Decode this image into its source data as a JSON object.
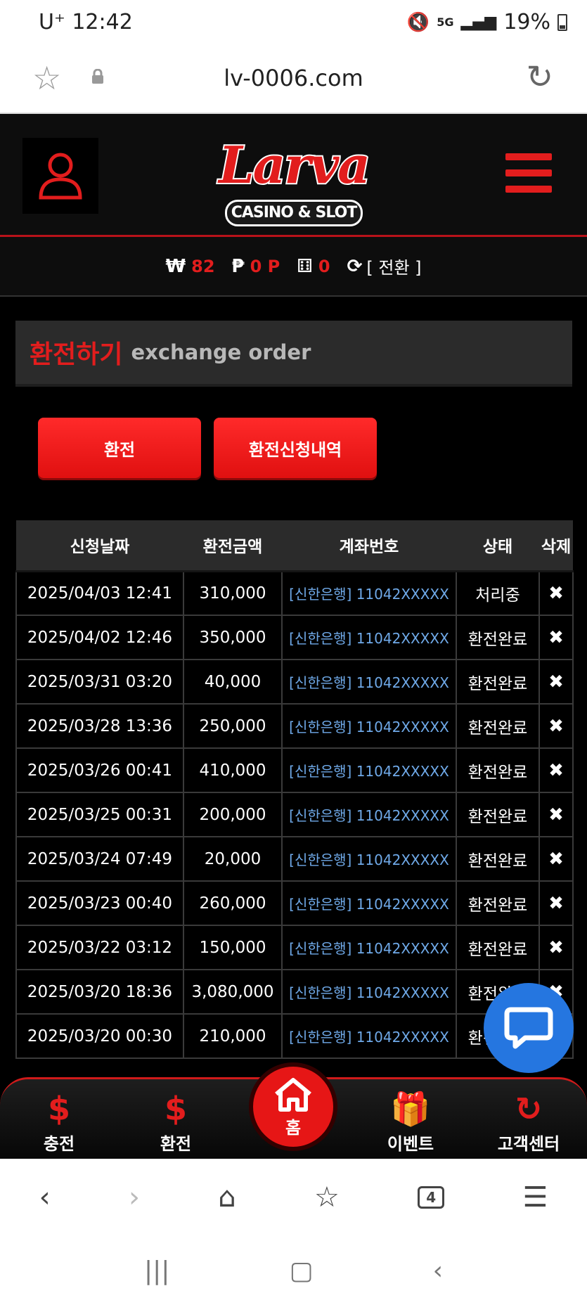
{
  "status_bar": {
    "time": "12:42",
    "carrier": "U⁺",
    "network": "5G",
    "battery": "19%"
  },
  "browser": {
    "url": "lv-0006.com"
  },
  "header": {
    "logo_text": "Larva",
    "logo_sub": "CASINO & SLOT"
  },
  "balance": {
    "won_symbol": "₩",
    "won_value": "82",
    "point_symbol": "₱",
    "point_value": "0 P",
    "chip_value": "0",
    "switch_label": "[ 전환 ]"
  },
  "section": {
    "title_ko": "환전하기",
    "title_en": "exchange order"
  },
  "actions": {
    "exchange_label": "환전",
    "history_label": "환전신청내역"
  },
  "table": {
    "headers": [
      "신청날짜",
      "환전금액",
      "계좌번호",
      "상태",
      "삭제"
    ],
    "rows": [
      {
        "date": "2025/04/03 12:41",
        "amount": "310,000",
        "account": "[신한은행] 11042XXXXX",
        "status": "처리중",
        "del": "✖"
      },
      {
        "date": "2025/04/02 12:46",
        "amount": "350,000",
        "account": "[신한은행] 11042XXXXX",
        "status": "환전완료",
        "del": "✖"
      },
      {
        "date": "2025/03/31 03:20",
        "amount": "40,000",
        "account": "[신한은행] 11042XXXXX",
        "status": "환전완료",
        "del": "✖"
      },
      {
        "date": "2025/03/28 13:36",
        "amount": "250,000",
        "account": "[신한은행] 11042XXXXX",
        "status": "환전완료",
        "del": "✖"
      },
      {
        "date": "2025/03/26 00:41",
        "amount": "410,000",
        "account": "[신한은행] 11042XXXXX",
        "status": "환전완료",
        "del": "✖"
      },
      {
        "date": "2025/03/25 00:31",
        "amount": "200,000",
        "account": "[신한은행] 11042XXXXX",
        "status": "환전완료",
        "del": "✖"
      },
      {
        "date": "2025/03/24 07:49",
        "amount": "20,000",
        "account": "[신한은행] 11042XXXXX",
        "status": "환전완료",
        "del": "✖"
      },
      {
        "date": "2025/03/23 00:40",
        "amount": "260,000",
        "account": "[신한은행] 11042XXXXX",
        "status": "환전완료",
        "del": "✖"
      },
      {
        "date": "2025/03/22 03:12",
        "amount": "150,000",
        "account": "[신한은행] 11042XXXXX",
        "status": "환전완료",
        "del": "✖"
      },
      {
        "date": "2025/03/20 18:36",
        "amount": "3,080,000",
        "account": "[신한은행] 11042XXXXX",
        "status": "환전완료",
        "del": "✖"
      },
      {
        "date": "2025/03/20 00:30",
        "amount": "210,000",
        "account": "[신한은행] 11042XXXXX",
        "status": "환전완료",
        "del": "✖"
      }
    ]
  },
  "bottom_nav": {
    "charge": "충전",
    "exchange": "환전",
    "home": "홈",
    "event": "이벤트",
    "support": "고객센터"
  },
  "browser_toolbar": {
    "tabs_count": "4"
  },
  "colors": {
    "accent": "#e21d1d",
    "account_link": "#6fa9e8",
    "chat": "#2576e0"
  }
}
